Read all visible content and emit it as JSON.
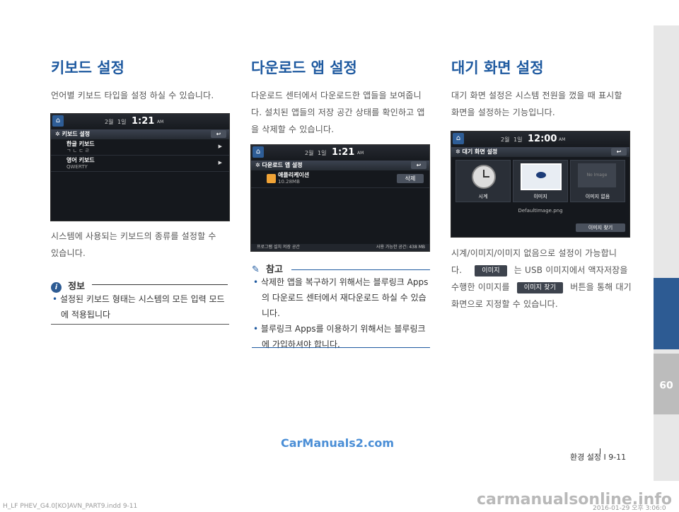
{
  "side": {
    "chapter_num": "09"
  },
  "col1": {
    "title": "키보드 설정",
    "para1": [
      "언어별 키보드 타입을 설정 하실 수 있습니다."
    ],
    "screen": {
      "date_label1": "2월",
      "date_label2": "1일",
      "time": "1:21",
      "ampm": "AM",
      "header": "키보드 설정",
      "rows": [
        {
          "title": "한글 키보드",
          "sub": "ㄱ ㄴ ㄷ ㄹ"
        },
        {
          "title": "영어 키보드",
          "sub": "QWERTY"
        }
      ]
    },
    "para2": [
      "시스템에 사용되는 키보드의 종류를 설정할 수",
      "있습니다."
    ],
    "info_label": "정보",
    "info_bullets": [
      [
        "설정된 키보드 형태는 시스템의 모든 입력 모드",
        "에 적용됩니다"
      ]
    ]
  },
  "col2": {
    "title": "다운로드 앱 설정",
    "para": [
      "다운로드 센터에서 다운로드한 앱들을 보여줍니",
      "다. 설치된 앱들의 저장 공간 상태를 확인하고 앱",
      "을 삭제할 수 있습니다."
    ],
    "screen": {
      "date_label1": "2월",
      "date_label2": "1일",
      "time": "1:21",
      "ampm": "AM",
      "header": "다운로드 앱 설정",
      "app_name": "애플리케이션",
      "app_size": "10.28MB",
      "delete_btn": "삭제",
      "footer_left": "프로그램 설치 저장 공간",
      "footer_right": "사용 가능한 공간: 438 MB"
    },
    "note_label": "참고",
    "note_bullets": [
      [
        "삭제한 앱을 복구하기 위해서는 블루링크 Apps",
        "의 다운로드 센터에서 재다운로드 하실 수 있습",
        "니다."
      ],
      [
        "블루링크 Apps를 이용하기 위해서는 블루링크",
        "에 가입하셔야 합니다."
      ]
    ]
  },
  "col3": {
    "title": "대기 화면 설정",
    "para1": [
      "대기 화면 설정은 시스템 전원을 껐을 때 표시할",
      "화면을 설정하는 기능입니다."
    ],
    "screen": {
      "date_label1": "2월",
      "date_label2": "1일",
      "time": "12:00",
      "ampm": "AM",
      "header": "대기 화면 설정",
      "tiles": [
        "시계",
        "이미지",
        "이미지 없음"
      ],
      "no_image": "No Image",
      "filename": "DefaultImage.png",
      "find_btn": "이미지 찾기"
    },
    "para2_line1": "시계/이미지/이미지 없음으로 설정이 가능합니",
    "para2_line2_a": "다.",
    "chip1": "이미지",
    "para2_line2_b": "는 USB 이미지에서 액자저장을",
    "para2_line3_a": "수행한 이미지를",
    "chip2": "이미지 찾기",
    "para2_line3_b": "버튼을 통해 대기",
    "para2_line4": "화면으로 지정할 수 있습니다."
  },
  "footer": {
    "page": "환경 설정 I 9-11",
    "file": "H_LF PHEV_G4.0[KO]AVN_PART9.indd   9-11",
    "date": "2016-01-29   오후 3:06:0",
    "watermark1": "CarManuals2.com",
    "watermark2": "carmanualsonline.info"
  }
}
